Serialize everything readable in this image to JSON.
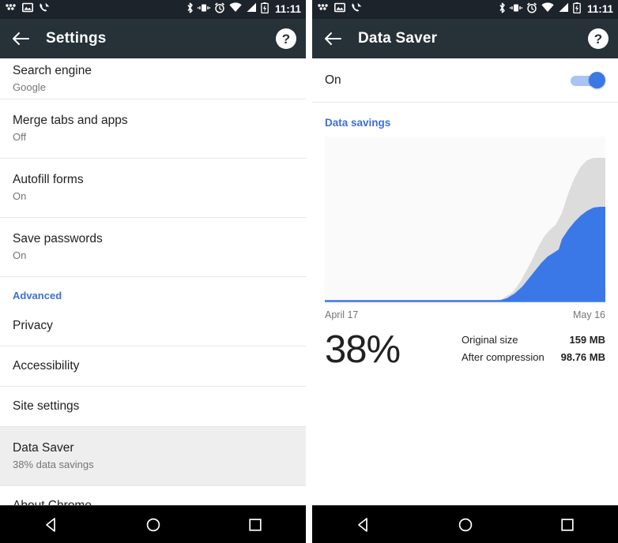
{
  "status_bar": {
    "time": "11:11",
    "left_icons": [
      "tidal-dots-icon",
      "image-icon",
      "phone-icon"
    ],
    "right_icons": [
      "bluetooth-icon",
      "vibrate-icon",
      "alarm-icon",
      "wifi-icon",
      "cellular-signal-icon",
      "battery-charging-icon"
    ]
  },
  "colors": {
    "toolbar_bg": "#263238",
    "statusbar_bg": "#1d232a",
    "accent_blue": "#3f6fd1",
    "chart_blue": "#3b78e7",
    "chart_gray": "#dcdcdc",
    "highlight_row": "#eeeeee",
    "navbar_bg": "#000000"
  },
  "settings_screen": {
    "toolbar": {
      "back_label": "Back",
      "title": "Settings",
      "help_label": "?"
    },
    "rows": [
      {
        "title": "Search engine",
        "subtitle": "Google",
        "type": "two-line",
        "highlight": false
      },
      {
        "title": "Merge tabs and apps",
        "subtitle": "Off",
        "type": "two-line",
        "highlight": false
      },
      {
        "title": "Autofill forms",
        "subtitle": "On",
        "type": "two-line",
        "highlight": false
      },
      {
        "title": "Save passwords",
        "subtitle": "On",
        "type": "two-line",
        "highlight": false
      }
    ],
    "section_header": "Advanced",
    "advanced_rows": [
      {
        "title": "Privacy",
        "subtitle": "",
        "type": "one-line",
        "highlight": false
      },
      {
        "title": "Accessibility",
        "subtitle": "",
        "type": "one-line",
        "highlight": false
      },
      {
        "title": "Site settings",
        "subtitle": "",
        "type": "one-line",
        "highlight": false
      },
      {
        "title": "Data Saver",
        "subtitle": "38% data savings",
        "type": "two-line",
        "highlight": true
      },
      {
        "title": "About Chrome",
        "subtitle": "",
        "type": "one-line",
        "highlight": false
      }
    ]
  },
  "data_saver_screen": {
    "toolbar": {
      "back_label": "Back",
      "title": "Data Saver",
      "help_label": "?"
    },
    "toggle": {
      "label": "On",
      "state": "on"
    },
    "section_title": "Data savings",
    "start_date": "April 17",
    "end_date": "May 16",
    "savings_percent": "38%",
    "stats": [
      {
        "label": "Original size",
        "value": "159 MB"
      },
      {
        "label": "After compression",
        "value": "98.76 MB"
      }
    ]
  },
  "chart_data": {
    "type": "area",
    "title": "Data savings",
    "xlabel": "",
    "ylabel": "",
    "x_start_label": "April 17",
    "x_end_label": "May 16",
    "grid": false,
    "legend": "none",
    "x": [
      0,
      5,
      10,
      15,
      20,
      25,
      30,
      35,
      40,
      45,
      50,
      55,
      60,
      65,
      70,
      72,
      75,
      78,
      80,
      83,
      86,
      89,
      92,
      95,
      98,
      100
    ],
    "series": [
      {
        "name": "Original size",
        "color": "#dcdcdc",
        "values": [
          0,
          0,
          0,
          0,
          0,
          0,
          0,
          0,
          0,
          0,
          0,
          0,
          0,
          0,
          2,
          6,
          16,
          28,
          36,
          44,
          50,
          62,
          74,
          84,
          88,
          88
        ]
      },
      {
        "name": "After compression",
        "color": "#3b78e7",
        "values": [
          0,
          0,
          0,
          0,
          0,
          0,
          0,
          0,
          0,
          0,
          0,
          0,
          0,
          0,
          1,
          3,
          9,
          17,
          23,
          28,
          33,
          44,
          52,
          57,
          57,
          57
        ]
      }
    ],
    "ylim": [
      0,
      100
    ],
    "annotations": {
      "savings_percent": "38%",
      "original_size": "159 MB",
      "after_compression": "98.76 MB"
    }
  },
  "nav_bar": {
    "back": "back-triangle-icon",
    "home": "home-circle-icon",
    "recents": "recents-square-icon"
  }
}
